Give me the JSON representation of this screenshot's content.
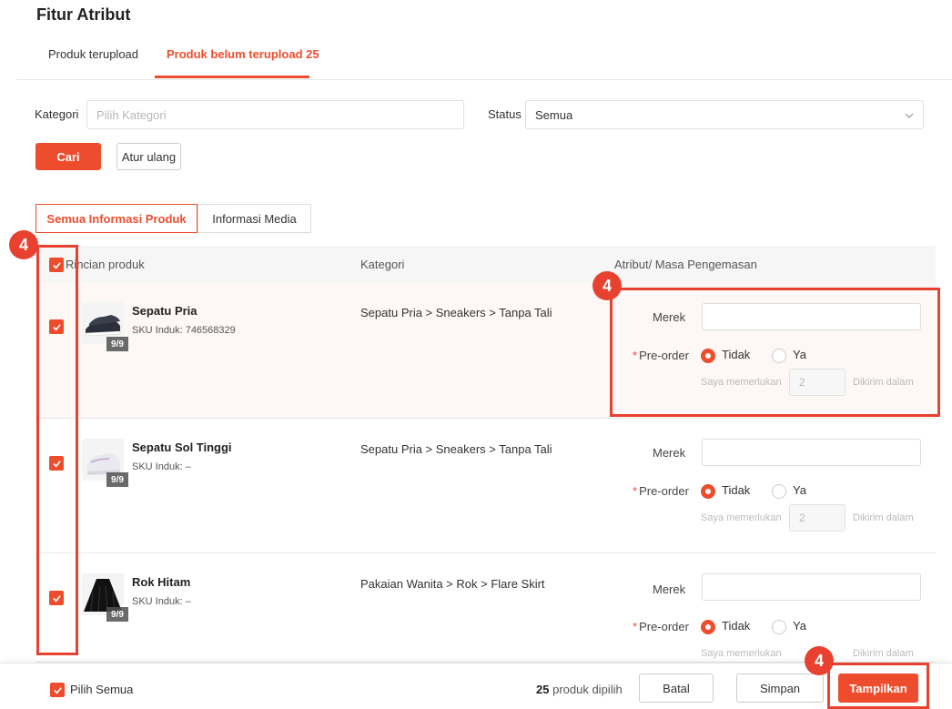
{
  "page": {
    "title": "Fitur Atribut"
  },
  "tabs": {
    "uploaded": "Produk terupload",
    "not_uploaded": "Produk belum terupload 25"
  },
  "filters": {
    "category_label": "Kategori",
    "category_placeholder": "Pilih Kategori",
    "status_label": "Status",
    "status_value": "Semua",
    "search_button": "Cari",
    "reset_button": "Atur ulang"
  },
  "segments": {
    "all_info": "Semua Informasi Produk",
    "media_info": "Informasi Media"
  },
  "table": {
    "headers": {
      "product": "Rincian produk",
      "category": "Kategori",
      "attributes": "Atribut/ Masa Pengemasan"
    },
    "rows": [
      {
        "name": "Sepatu Pria",
        "sku": "SKU Induk: 746568329",
        "badge": "9/9",
        "category": "Sepatu Pria > Sneakers > Tanpa Tali",
        "checked": true
      },
      {
        "name": "Sepatu Sol Tinggi",
        "sku": "SKU Induk: –",
        "badge": "9/9",
        "category": "Sepatu Pria > Sneakers > Tanpa Tali",
        "checked": true
      },
      {
        "name": "Rok Hitam",
        "sku": "SKU Induk: –",
        "badge": "9/9",
        "category": "Pakaian Wanita > Rok > Flare Skirt",
        "checked": true
      }
    ],
    "attr_labels": {
      "merek": "Merek",
      "preorder_required": "*",
      "preorder": "Pre-order",
      "option_no": "Tidak",
      "option_yes": "Ya",
      "need_text": "Saya memerlukan",
      "days_value": "2",
      "ship_text": "Dikirim dalam"
    }
  },
  "annotations": {
    "step": "4"
  },
  "footer": {
    "select_all": "Pilih Semua",
    "count_number": "25",
    "count_text": "produk dipilih",
    "cancel": "Batal",
    "save": "Simpan",
    "show": "Tampilkan"
  },
  "colors": {
    "accent": "#ee4d2d",
    "annotation": "#e8412f"
  },
  "icons": {
    "checkbox": "checkmark-icon",
    "select_chevron": "chevron-down-icon"
  }
}
